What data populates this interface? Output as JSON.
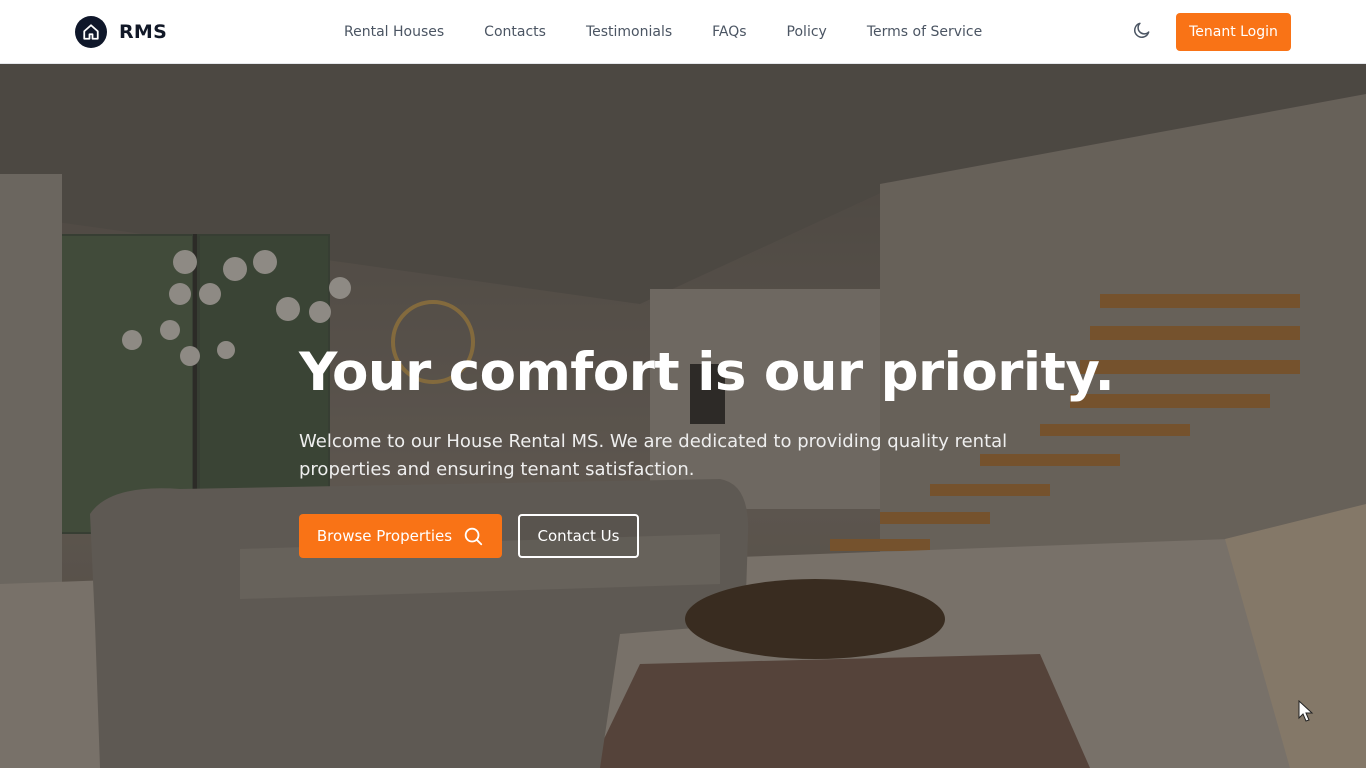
{
  "brand": {
    "name": "RMS",
    "logo_icon": "house-icon"
  },
  "nav": {
    "items": [
      {
        "label": "Rental Houses"
      },
      {
        "label": "Contacts"
      },
      {
        "label": "Testimonials"
      },
      {
        "label": "FAQs"
      },
      {
        "label": "Policy"
      },
      {
        "label": "Terms of Service"
      }
    ]
  },
  "header": {
    "theme_icon": "moon-icon",
    "login_label": "Tenant Login"
  },
  "hero": {
    "title": "Your comfort is our priority.",
    "subtitle": "Welcome to our House Rental MS. We are dedicated to providing quality rental properties and ensuring tenant satisfaction.",
    "primary_label": "Browse Properties",
    "primary_icon": "search-icon",
    "secondary_label": "Contact Us"
  },
  "colors": {
    "accent": "#f97316",
    "brand_dark": "#0f172a",
    "nav_text": "#4b5563"
  }
}
